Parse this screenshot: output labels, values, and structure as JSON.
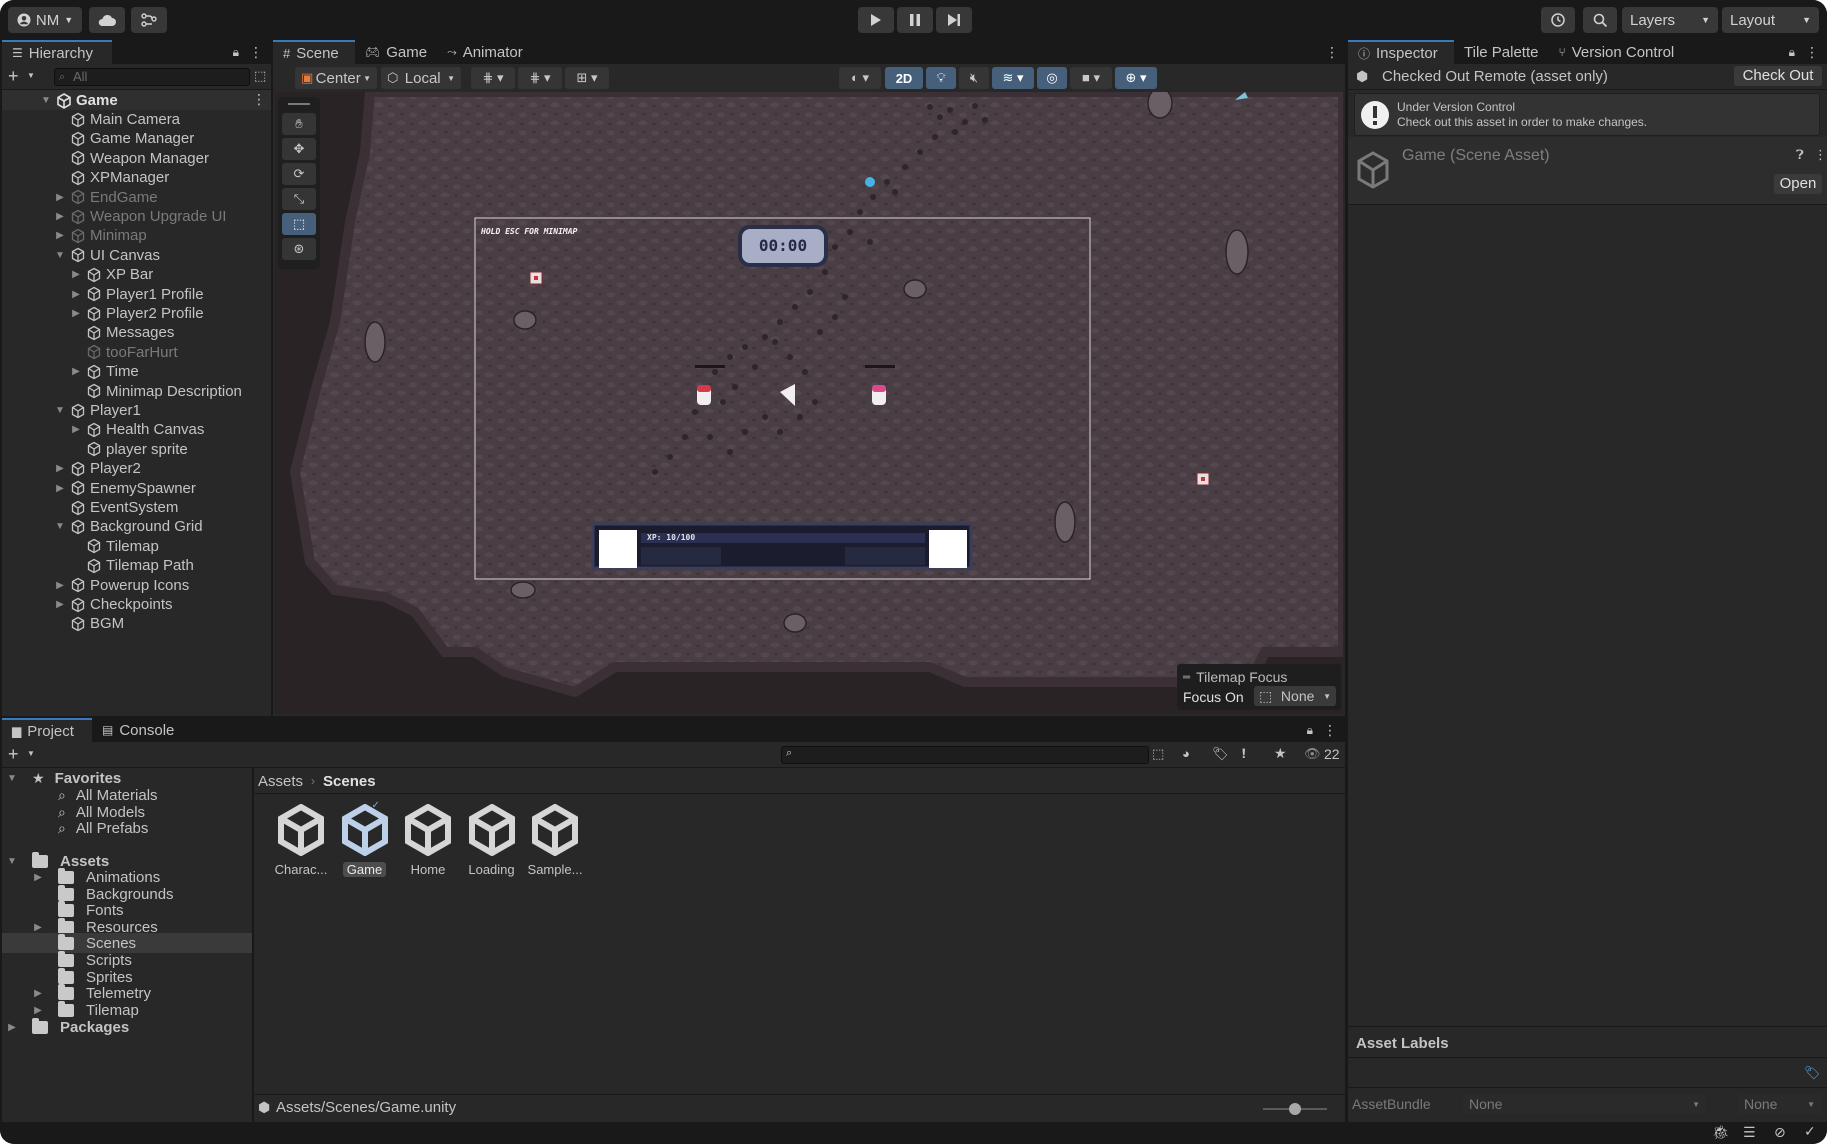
{
  "toolbar": {
    "account": "NM",
    "layers": "Layers",
    "layout": "Layout"
  },
  "hierarchy": {
    "tab": "Hierarchy",
    "search_placeholder": "All",
    "root": "Game",
    "items": [
      {
        "label": "Main Camera",
        "indent": 1,
        "arrow": false,
        "dim": false
      },
      {
        "label": "Game Manager",
        "indent": 1,
        "arrow": false,
        "dim": false
      },
      {
        "label": "Weapon Manager",
        "indent": 1,
        "arrow": false,
        "dim": false
      },
      {
        "label": "XPManager",
        "indent": 1,
        "arrow": false,
        "dim": false
      },
      {
        "label": "EndGame",
        "indent": 1,
        "arrow": "right",
        "dim": true
      },
      {
        "label": "Weapon Upgrade UI",
        "indent": 1,
        "arrow": "right",
        "dim": true
      },
      {
        "label": "Minimap",
        "indent": 1,
        "arrow": "right",
        "dim": true
      },
      {
        "label": "UI Canvas",
        "indent": 1,
        "arrow": "down",
        "dim": false
      },
      {
        "label": "XP Bar",
        "indent": 2,
        "arrow": "right",
        "dim": false
      },
      {
        "label": "Player1 Profile",
        "indent": 2,
        "arrow": "right",
        "dim": false
      },
      {
        "label": "Player2 Profile",
        "indent": 2,
        "arrow": "right",
        "dim": false
      },
      {
        "label": "Messages",
        "indent": 2,
        "arrow": false,
        "dim": false
      },
      {
        "label": "tooFarHurt",
        "indent": 2,
        "arrow": false,
        "dim": true
      },
      {
        "label": "Time",
        "indent": 2,
        "arrow": "right",
        "dim": false
      },
      {
        "label": "Minimap Description",
        "indent": 2,
        "arrow": false,
        "dim": false
      },
      {
        "label": "Player1",
        "indent": 1,
        "arrow": "down",
        "dim": false
      },
      {
        "label": "Health Canvas",
        "indent": 2,
        "arrow": "right",
        "dim": false
      },
      {
        "label": "player sprite",
        "indent": 2,
        "arrow": false,
        "dim": false
      },
      {
        "label": "Player2",
        "indent": 1,
        "arrow": "right",
        "dim": false
      },
      {
        "label": "EnemySpawner",
        "indent": 1,
        "arrow": "right",
        "dim": false
      },
      {
        "label": "EventSystem",
        "indent": 1,
        "arrow": false,
        "dim": false
      },
      {
        "label": "Background Grid",
        "indent": 1,
        "arrow": "down",
        "dim": false
      },
      {
        "label": "Tilemap",
        "indent": 2,
        "arrow": false,
        "dim": false
      },
      {
        "label": "Tilemap Path",
        "indent": 2,
        "arrow": false,
        "dim": false
      },
      {
        "label": "Powerup Icons",
        "indent": 1,
        "arrow": "right",
        "dim": false
      },
      {
        "label": "Checkpoints",
        "indent": 1,
        "arrow": "right",
        "dim": false
      },
      {
        "label": "BGM",
        "indent": 1,
        "arrow": false,
        "dim": false
      }
    ]
  },
  "scene": {
    "tabs": [
      "Scene",
      "Game",
      "Animator"
    ],
    "center": "Center",
    "local": "Local",
    "mode2d": "2D",
    "hud_hint": "HOLD ESC FOR MINIMAP",
    "timer": "00:00",
    "xp_text": "XP: 10/100",
    "tilemap_focus_title": "Tilemap Focus",
    "focus_on_label": "Focus On",
    "focus_on_value": "None"
  },
  "inspector": {
    "tabs": [
      "Inspector",
      "Tile Palette",
      "Version Control"
    ],
    "status": "Checked Out Remote (asset only)",
    "checkout_button": "Check Out",
    "vc_title": "Under Version Control",
    "vc_message": "Check out this asset in order to make changes.",
    "asset_title": "Game (Scene Asset)",
    "open_button": "Open",
    "asset_labels": "Asset Labels",
    "assetbundle_label": "AssetBundle",
    "assetbundle_value": "None",
    "variant_value": "None"
  },
  "project": {
    "tabs": [
      "Project",
      "Console"
    ],
    "hidden_count": "22",
    "favorites_label": "Favorites",
    "favorites": [
      "All Materials",
      "All Models",
      "All Prefabs"
    ],
    "assets_label": "Assets",
    "folders": [
      {
        "label": "Animations",
        "arrow": true
      },
      {
        "label": "Backgrounds",
        "arrow": false
      },
      {
        "label": "Fonts",
        "arrow": false
      },
      {
        "label": "Resources",
        "arrow": true
      },
      {
        "label": "Scenes",
        "arrow": false,
        "selected": true
      },
      {
        "label": "Scripts",
        "arrow": false
      },
      {
        "label": "Sprites",
        "arrow": false
      },
      {
        "label": "Telemetry",
        "arrow": true
      },
      {
        "label": "Tilemap",
        "arrow": true
      }
    ],
    "packages_label": "Packages",
    "breadcrumb": [
      "Assets",
      "Scenes"
    ],
    "grid_items": [
      "Charac...",
      "Game",
      "Home",
      "Loading",
      "Sample..."
    ],
    "selected_item": "Game",
    "path": "Assets/Scenes/Game.unity"
  },
  "colors": {
    "accent": "#3a79bb",
    "ground": "#4a3e45",
    "edge": "#2a2326"
  }
}
